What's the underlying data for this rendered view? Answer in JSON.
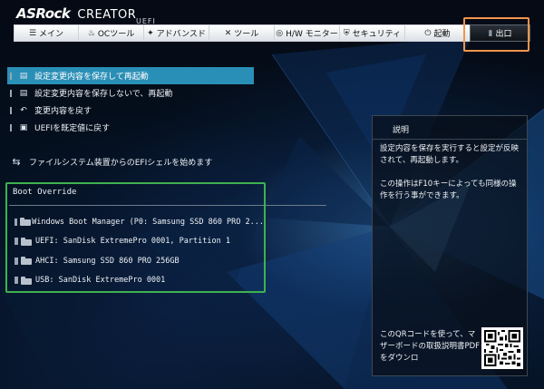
{
  "header": {
    "brand": "ASRock",
    "edition": "CREATOR",
    "subtitle": "UEFI"
  },
  "tabs": [
    {
      "label": "メイン",
      "icon": "list-icon",
      "glyph": "☰"
    },
    {
      "label": "OCツール",
      "icon": "flame-icon",
      "glyph": "♨"
    },
    {
      "label": "アドバンスド",
      "icon": "star-icon",
      "glyph": "✦"
    },
    {
      "label": "ツール",
      "icon": "tools-icon",
      "glyph": "✕"
    },
    {
      "label": "H/W モニター",
      "icon": "monitor-icon",
      "glyph": "◎"
    },
    {
      "label": "セキュリティ",
      "icon": "shield-icon",
      "glyph": "⛨"
    },
    {
      "label": "起動",
      "icon": "power-icon",
      "glyph": "⏻"
    },
    {
      "label": "出口",
      "icon": "exit-icon",
      "glyph": "▮",
      "active": true
    }
  ],
  "menu": {
    "items": [
      {
        "label": "設定変更内容を保存して再起動",
        "icon": "save-icon",
        "selected": true
      },
      {
        "label": "設定変更内容を保存しないで、再起動",
        "icon": "save-icon"
      },
      {
        "label": "変更内容を戻す",
        "icon": "undo-icon"
      },
      {
        "label": "UEFIを既定値に戻す",
        "icon": "reset-icon"
      }
    ],
    "efi_shell": "ファイルシステム装置からのEFIシェルを始めます"
  },
  "boot_override": {
    "title": "Boot Override",
    "devices": [
      "Windows Boot Manager (P0: Samsung SSD 860 PRO 2...",
      "UEFI: SanDisk ExtremePro 0001, Partition 1",
      "AHCI:  Samsung SSD 860 PRO 256GB",
      "USB: SanDisk ExtremePro 0001"
    ]
  },
  "description": {
    "title": "説明",
    "lines": [
      "設定内容を保存を実行すると設定が反映されて、再起動します。",
      "この操作はF10キーによっても同様の操作を行う事ができます。"
    ],
    "qr_text": "このQRコードを使って、マザーボードの取扱説明書PDFをダウンロ"
  },
  "colors": {
    "selection": "#2a8fb6",
    "exit_highlight": "#f2954a",
    "boot_highlight": "#3fb14f"
  }
}
